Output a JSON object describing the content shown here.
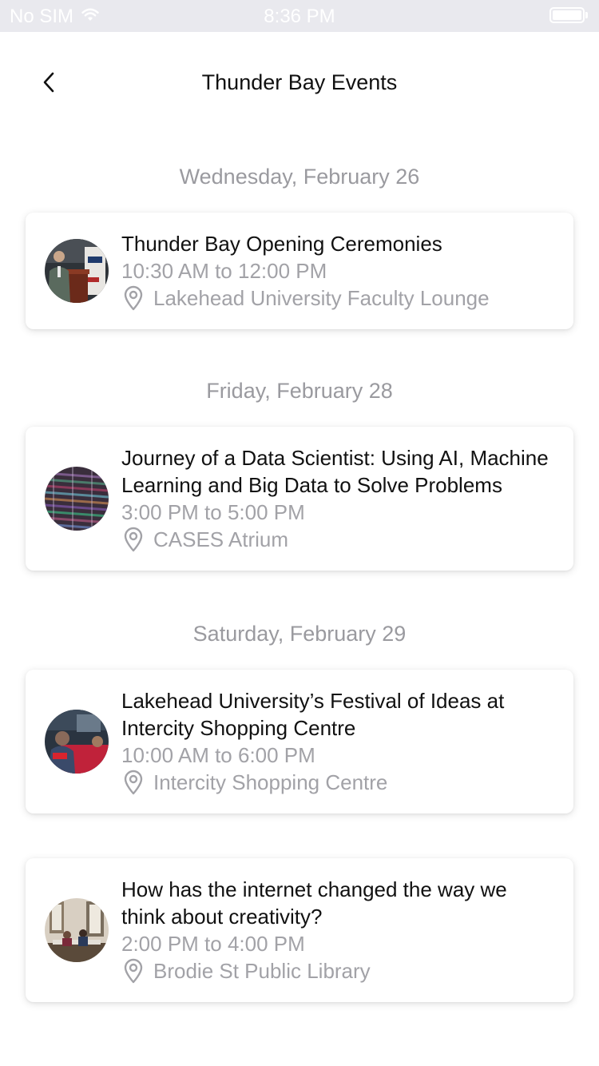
{
  "status_bar": {
    "carrier": "No SIM",
    "time": "8:36 PM",
    "battery_level": 1.0,
    "wifi_icon": "wifi-icon",
    "battery_icon": "battery-icon"
  },
  "header": {
    "title": "Thunder Bay Events",
    "back_icon": "chevron-left-icon"
  },
  "days": [
    {
      "label": "Wednesday, February 26",
      "events": [
        {
          "title": "Thunder Bay Opening Ceremonies",
          "time": "10:30 AM to 12:00 PM",
          "location": "Lakehead University Faculty Lounge",
          "location_icon": "map-pin-icon"
        }
      ]
    },
    {
      "label": "Friday, February 28",
      "events": [
        {
          "title": "Journey of a Data Scientist: Using AI, Machine Learning and Big Data to Solve Problems",
          "time": "3:00 PM to 5:00 PM",
          "location": "CASES Atrium",
          "location_icon": "map-pin-icon"
        }
      ]
    },
    {
      "label": "Saturday, February 29",
      "events": [
        {
          "title": "Lakehead University’s Festival of Ideas at Intercity Shopping Centre",
          "time": "10:00 AM to 6:00 PM",
          "location": "Intercity Shopping Centre",
          "location_icon": "map-pin-icon"
        },
        {
          "title": "How has the internet changed the way we think about creativity?",
          "time": "2:00 PM to 4:00 PM",
          "location": "Brodie St Public Library",
          "location_icon": "map-pin-icon"
        }
      ]
    }
  ],
  "colors": {
    "status_bar_bg": "#e9e9ee",
    "secondary_text": "#a2a2a7",
    "day_header_text": "#9a9a9f",
    "primary_text": "#111111"
  }
}
